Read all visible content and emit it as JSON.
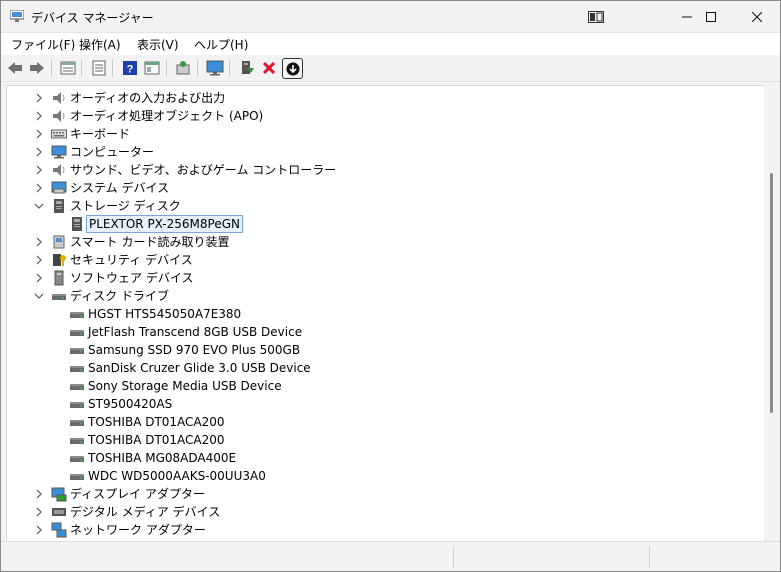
{
  "window": {
    "title": "デバイス マネージャー"
  },
  "menu": [
    {
      "label": "ファイル(F)"
    },
    {
      "label": "操作(A)"
    },
    {
      "label": "表示(V)"
    },
    {
      "label": "ヘルプ(H)"
    }
  ],
  "toolbar_icons": [
    "back-arrow-icon",
    "forward-arrow-icon",
    "properties-icon",
    "update-list-icon",
    "help-icon",
    "view-icon",
    "scan-hardware-icon",
    "monitor-icon",
    "enable-device-icon",
    "uninstall-icon",
    "download-driver-icon"
  ],
  "tree": [
    {
      "label": "オーディオの入力および出力",
      "icon": "speaker-icon",
      "expanded": false,
      "level": 0
    },
    {
      "label": "オーディオ処理オブジェクト (APO)",
      "icon": "speaker-icon",
      "expanded": false,
      "level": 0
    },
    {
      "label": "キーボード",
      "icon": "keyboard-icon",
      "expanded": false,
      "level": 0
    },
    {
      "label": "コンピューター",
      "icon": "computer-icon",
      "expanded": false,
      "level": 0
    },
    {
      "label": "サウンド、ビデオ、およびゲーム コントローラー",
      "icon": "speaker-icon",
      "expanded": false,
      "level": 0
    },
    {
      "label": "システム デバイス",
      "icon": "system-device-icon",
      "expanded": false,
      "level": 0
    },
    {
      "label": "ストレージ ディスク",
      "icon": "storage-icon",
      "expanded": true,
      "level": 0
    },
    {
      "label": "PLEXTOR PX-256M8PeGN",
      "icon": "storage-icon",
      "level": 1,
      "selected": true
    },
    {
      "label": "スマート カード読み取り装置",
      "icon": "smartcard-reader-icon",
      "expanded": false,
      "level": 0
    },
    {
      "label": "セキュリティ デバイス",
      "icon": "security-key-icon",
      "expanded": false,
      "level": 0
    },
    {
      "label": "ソフトウェア デバイス",
      "icon": "software-device-icon",
      "expanded": false,
      "level": 0
    },
    {
      "label": "ディスク ドライブ",
      "icon": "disk-drive-icon",
      "expanded": true,
      "level": 0
    },
    {
      "label": "HGST HTS545050A7E380",
      "icon": "disk-drive-icon",
      "level": 1
    },
    {
      "label": "JetFlash Transcend 8GB USB Device",
      "icon": "disk-drive-icon",
      "level": 1
    },
    {
      "label": "Samsung SSD 970 EVO Plus 500GB",
      "icon": "disk-drive-icon",
      "level": 1
    },
    {
      "label": "SanDisk Cruzer Glide 3.0 USB Device",
      "icon": "disk-drive-icon",
      "level": 1
    },
    {
      "label": "Sony Storage Media USB Device",
      "icon": "disk-drive-icon",
      "level": 1
    },
    {
      "label": "ST9500420AS",
      "icon": "disk-drive-icon",
      "level": 1
    },
    {
      "label": "TOSHIBA DT01ACA200",
      "icon": "disk-drive-icon",
      "level": 1
    },
    {
      "label": "TOSHIBA DT01ACA200",
      "icon": "disk-drive-icon",
      "level": 1
    },
    {
      "label": "TOSHIBA MG08ADA400E",
      "icon": "disk-drive-icon",
      "level": 1
    },
    {
      "label": "WDC WD5000AAKS-00UU3A0",
      "icon": "disk-drive-icon",
      "level": 1
    },
    {
      "label": "ディスプレイ アダプター",
      "icon": "display-adapter-icon",
      "expanded": false,
      "level": 0
    },
    {
      "label": "デジタル メディア デバイス",
      "icon": "digital-media-icon",
      "expanded": false,
      "level": 0
    },
    {
      "label": "ネットワーク アダプター",
      "icon": "network-adapter-icon",
      "expanded": false,
      "level": 0
    }
  ],
  "colors": {
    "selection_bg": "#e5f0fb",
    "selection_border": "#7aa7d9",
    "uninstall_red": "#e81123",
    "help_blue": "#1e3fa8"
  }
}
